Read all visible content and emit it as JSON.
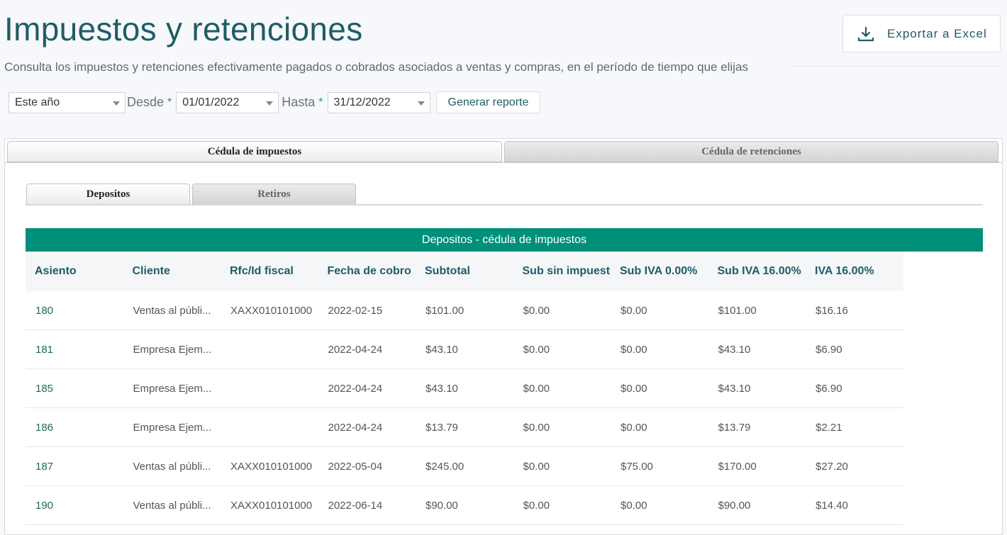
{
  "header": {
    "title": "Impuestos y retenciones",
    "subtitle": "Consulta los impuestos y retenciones efectivamente pagados o cobrados asociados a ventas y compras, en el período de tiempo que elijas",
    "export_label": "Exportar a Excel"
  },
  "filters": {
    "period": "Este año",
    "desde_label": "Desde",
    "desde_value": "01/01/2022",
    "hasta_label": "Hasta",
    "hasta_value": "31/12/2022",
    "required_mark": "*",
    "generate_label": "Generar reporte"
  },
  "tabs": {
    "outer": [
      "Cédula de impuestos",
      "Cédula de retenciones"
    ],
    "inner": [
      "Depositos",
      "Retiros"
    ]
  },
  "grid": {
    "title": "Depositos - cédula de impuestos",
    "columns": [
      "Asiento",
      "Cliente",
      "Rfc/Id fiscal",
      "Fecha de cobro",
      "Subtotal",
      "Sub sin impuesto",
      "Sub IVA 0.00%",
      "Sub IVA 16.00%",
      "IVA 16.00%"
    ],
    "rows": [
      [
        "180",
        "Ventas al públi...",
        "XAXX010101000",
        "2022-02-15",
        "$101.00",
        "$0.00",
        "$0.00",
        "$101.00",
        "$16.16"
      ],
      [
        "181",
        "Empresa Ejem...",
        "",
        "2022-04-24",
        "$43.10",
        "$0.00",
        "$0.00",
        "$43.10",
        "$6.90"
      ],
      [
        "185",
        "Empresa Ejem...",
        "",
        "2022-04-24",
        "$43.10",
        "$0.00",
        "$0.00",
        "$43.10",
        "$6.90"
      ],
      [
        "186",
        "Empresa Ejem...",
        "",
        "2022-04-24",
        "$13.79",
        "$0.00",
        "$0.00",
        "$13.79",
        "$2.21"
      ],
      [
        "187",
        "Ventas al públi...",
        "XAXX010101000",
        "2022-05-04",
        "$245.00",
        "$0.00",
        "$75.00",
        "$170.00",
        "$27.20"
      ],
      [
        "190",
        "Ventas al públi...",
        "XAXX010101000",
        "2022-06-14",
        "$90.00",
        "$0.00",
        "$0.00",
        "$90.00",
        "$14.40"
      ]
    ]
  }
}
